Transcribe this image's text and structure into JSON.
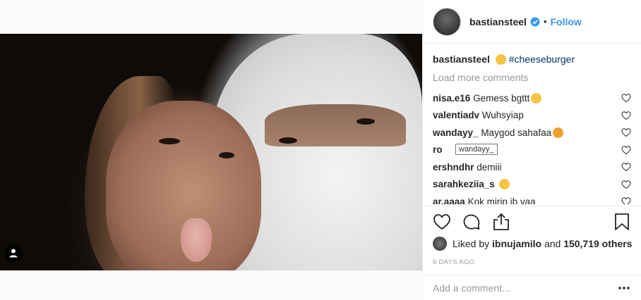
{
  "post": {
    "photo": {
      "user_tag_icon": "person-icon"
    }
  },
  "header": {
    "username": "bastiansteel",
    "verified_icon": "verified-badge-icon",
    "separator": "•",
    "follow_label": "Follow"
  },
  "caption": {
    "username": "bastiansteel",
    "emoji": "thinking-face",
    "hashtag": "#cheeseburger"
  },
  "load_more_label": "Load more comments",
  "comments": [
    {
      "username": "nisa.e16",
      "text": "Gemess bgttt",
      "emoji": "crying-face"
    },
    {
      "username": "valentiadv",
      "text": "Wuhsyiap",
      "emoji": ""
    },
    {
      "username": "wandayy_",
      "text": "Maygod sahafaa",
      "emoji": "star-struck"
    },
    {
      "username": "ro",
      "text": "",
      "emoji": ""
    },
    {
      "username": "ershndhr",
      "text": "demiii",
      "emoji": ""
    },
    {
      "username": "sarahkeziia_s",
      "text": "",
      "emoji": "grinning-face"
    },
    {
      "username": "ar.aaaa",
      "text": "Kok mirip ib vaa",
      "emoji": ""
    }
  ],
  "tooltip": "wandayy_",
  "actions": {
    "like_icon": "heart-icon",
    "comment_icon": "comment-icon",
    "share_icon": "share-icon",
    "save_icon": "bookmark-icon"
  },
  "likes": {
    "prefix": "Liked by",
    "user": "ibnujamilo",
    "middle": "and",
    "count": "150,719 others"
  },
  "timestamp": "6 DAYS AGO",
  "add_comment_placeholder": "Add a comment...",
  "colors": {
    "accent": "#3897f0",
    "hashtag": "#003569",
    "muted": "#999999"
  }
}
